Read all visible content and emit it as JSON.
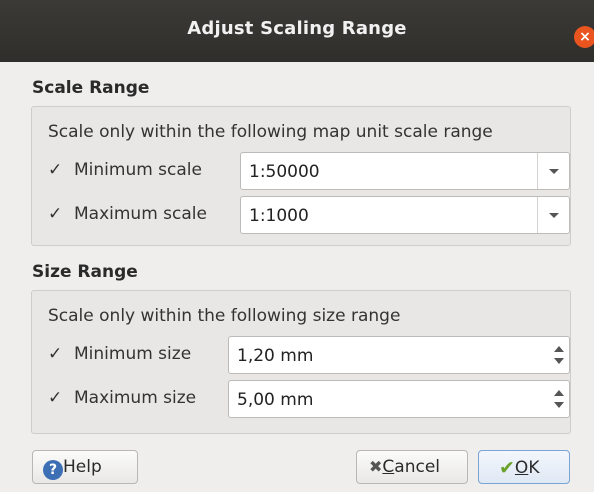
{
  "window": {
    "title": "Adjust Scaling Range",
    "close_glyph": "×"
  },
  "scale_range": {
    "title": "Scale Range",
    "description": "Scale only within the following map unit scale range",
    "minimum": {
      "checked": true,
      "check_glyph": "✓",
      "label": "Minimum scale",
      "value": "1:50000"
    },
    "maximum": {
      "checked": true,
      "check_glyph": "✓",
      "label": "Maximum scale",
      "value": "1:1000"
    }
  },
  "size_range": {
    "title": "Size Range",
    "description": "Scale only within the following size range",
    "minimum": {
      "checked": true,
      "check_glyph": "✓",
      "label": "Minimum size",
      "value": "1,20 mm"
    },
    "maximum": {
      "checked": true,
      "check_glyph": "✓",
      "label": "Maximum size",
      "value": "5,00 mm"
    }
  },
  "buttons": {
    "help": {
      "label": "Help",
      "icon": "?"
    },
    "cancel": {
      "label_underlined": "C",
      "label_rest": "ancel",
      "icon": "✖"
    },
    "ok": {
      "label_underlined": "O",
      "label_rest": "K",
      "icon": "✔"
    }
  },
  "colors": {
    "accent_close": "#e9541f",
    "ok_check": "#6aa12a",
    "help_icon": "#3d6fb4"
  }
}
